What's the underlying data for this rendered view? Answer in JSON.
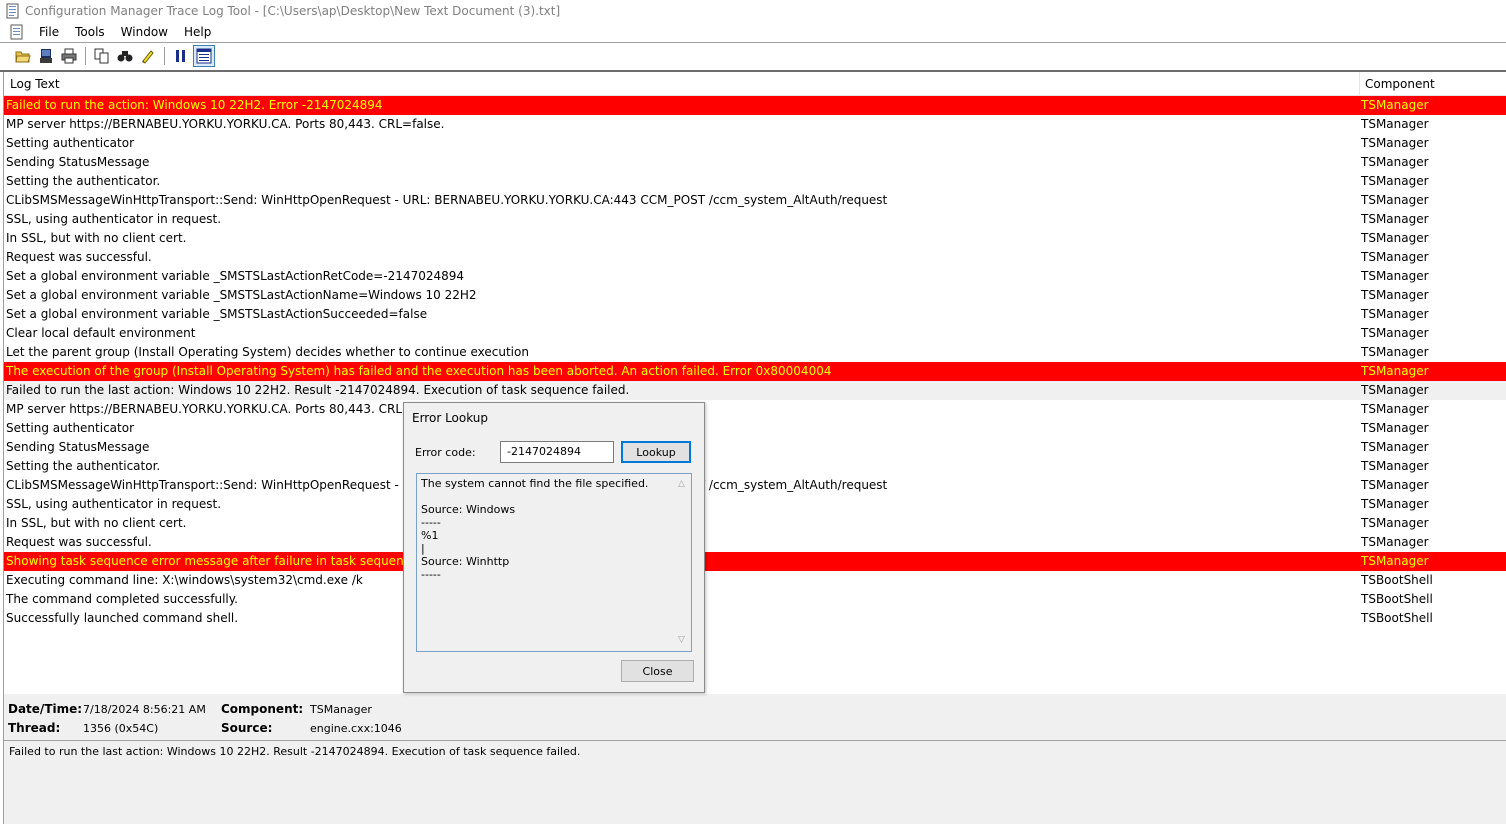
{
  "window": {
    "title": "Configuration Manager Trace Log Tool - [C:\\Users\\ap\\Desktop\\New Text Document (3).txt]"
  },
  "menu": {
    "items": [
      {
        "label": "File"
      },
      {
        "label": "Tools"
      },
      {
        "label": "Window"
      },
      {
        "label": "Help"
      }
    ]
  },
  "toolbar": {
    "buttons": [
      "open-icon",
      "print-preview-icon",
      "print-icon",
      "copy-icon",
      "find-icon",
      "highlight-icon",
      "pause-icon",
      "details-pane-icon"
    ]
  },
  "grid": {
    "columns": {
      "log_text": "Log Text",
      "component": "Component"
    },
    "rows": [
      {
        "text": "Failed to run the action: Windows 10 22H2. Error -2147024894",
        "component": "TSManager",
        "type": "error"
      },
      {
        "text": "MP server https://BERNABEU.YORKU.YORKU.CA. Ports 80,443. CRL=false.",
        "component": "TSManager",
        "type": "normal"
      },
      {
        "text": "Setting authenticator",
        "component": "TSManager",
        "type": "normal"
      },
      {
        "text": "Sending StatusMessage",
        "component": "TSManager",
        "type": "normal"
      },
      {
        "text": "Setting the authenticator.",
        "component": "TSManager",
        "type": "normal"
      },
      {
        "text": "CLibSMSMessageWinHttpTransport::Send: WinHttpOpenRequest - URL: BERNABEU.YORKU.YORKU.CA:443 CCM_POST /ccm_system_AltAuth/request",
        "component": "TSManager",
        "type": "normal"
      },
      {
        "text": "SSL, using authenticator in request.",
        "component": "TSManager",
        "type": "normal"
      },
      {
        "text": "In SSL, but with no client cert.",
        "component": "TSManager",
        "type": "normal"
      },
      {
        "text": "Request was successful.",
        "component": "TSManager",
        "type": "normal"
      },
      {
        "text": "Set a global environment variable _SMSTSLastActionRetCode=-2147024894",
        "component": "TSManager",
        "type": "normal"
      },
      {
        "text": "Set a global environment variable _SMSTSLastActionName=Windows 10 22H2",
        "component": "TSManager",
        "type": "normal"
      },
      {
        "text": "Set a global environment variable _SMSTSLastActionSucceeded=false",
        "component": "TSManager",
        "type": "normal"
      },
      {
        "text": "Clear local default environment",
        "component": "TSManager",
        "type": "normal"
      },
      {
        "text": "Let the parent group (Install Operating System) decides whether to continue execution",
        "component": "TSManager",
        "type": "normal"
      },
      {
        "text": "The execution of the group (Install Operating System) has failed and the execution has been aborted. An action failed. Error 0x80004004",
        "component": "TSManager",
        "type": "error"
      },
      {
        "text": "Failed to run the last action: Windows 10 22H2. Result -2147024894. Execution of task sequence failed.",
        "component": "TSManager",
        "type": "selected"
      },
      {
        "text": "MP server https://BERNABEU.YORKU.YORKU.CA. Ports 80,443. CRL=false.",
        "component": "TSManager",
        "type": "normal"
      },
      {
        "text": "Setting authenticator",
        "component": "TSManager",
        "type": "normal"
      },
      {
        "text": "Sending StatusMessage",
        "component": "TSManager",
        "type": "normal"
      },
      {
        "text": "Setting the authenticator.",
        "component": "TSManager",
        "type": "normal"
      },
      {
        "text": "CLibSMSMessageWinHttpTransport::Send: WinHttpOpenRequest - URL: BERNABEU.YORKU.YORKU.CA:443 CCM_POST /ccm_system_AltAuth/request",
        "component": "TSManager",
        "type": "normal"
      },
      {
        "text": "SSL, using authenticator in request.",
        "component": "TSManager",
        "type": "normal"
      },
      {
        "text": "In SSL, but with no client cert.",
        "component": "TSManager",
        "type": "normal"
      },
      {
        "text": "Request was successful.",
        "component": "TSManager",
        "type": "normal"
      },
      {
        "text": "Showing task sequence error message after failure in task sequence step of t",
        "component": "TSManager",
        "type": "error"
      },
      {
        "text": "Executing command line: X:\\windows\\system32\\cmd.exe /k",
        "component": "TSBootShell",
        "type": "normal"
      },
      {
        "text": "The command completed successfully.",
        "component": "TSBootShell",
        "type": "normal"
      },
      {
        "text": "Successfully launched command shell.",
        "component": "TSBootShell",
        "type": "normal"
      }
    ]
  },
  "details": {
    "datetime_label": "Date/Time:",
    "datetime_value": "7/18/2024 8:56:21 AM",
    "component_label": "Component:",
    "component_value": "TSManager",
    "thread_label": "Thread:",
    "thread_value": "1356 (0x54C)",
    "source_label": "Source:",
    "source_value": "engine.cxx:1046",
    "message": "Failed to run the last action: Windows 10 22H2. Result -2147024894. Execution of task sequence failed."
  },
  "dialog": {
    "title": "Error Lookup",
    "code_label": "Error code:",
    "code_value": "-2147024894",
    "lookup_label": "Lookup",
    "result_lines": [
      "The system cannot find the file specified.",
      "",
      "Source: Windows",
      "-----",
      "%1",
      "|",
      "Source: Winhttp",
      "-----"
    ],
    "close_label": "Close"
  },
  "colors": {
    "error_bg": "#ff0000",
    "error_text": "#ffff00",
    "selected_bg": "#f0f0f0",
    "panel_bg": "#f0f0f0"
  }
}
